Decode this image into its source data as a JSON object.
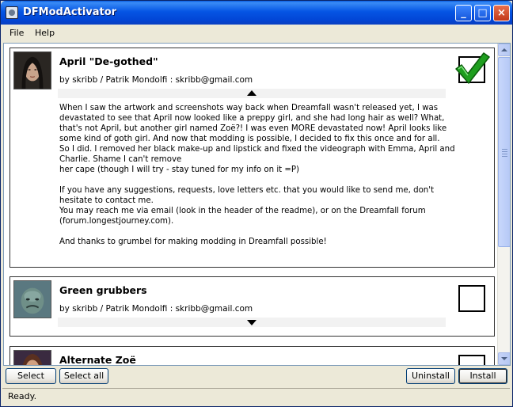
{
  "window": {
    "title": "DFModActivator"
  },
  "titlebar_buttons": {
    "minimize": "_",
    "maximize": "□",
    "close": "×"
  },
  "menu": {
    "file": "File",
    "help": "Help"
  },
  "mods": [
    {
      "title": "April \"De-gothed\"",
      "author": "by skribb / Patrik Mondolfi : skribb@gmail.com",
      "checked": true,
      "expanded": true,
      "description": [
        "When I saw the artwork and screenshots way back when Dreamfall wasn't released yet, I was\ndevastated to see that April now looked like a preppy girl, and she had long hair as well? What,\nthat's not April, but another girl named Zoë?! I was even MORE devastated now! April looks like\nsome kind of goth girl. And now that modding is possible, I decided to fix this once and for all.\nSo I did. I removed her black make-up and lipstick and fixed the videograph with Emma, April and\nCharlie. Shame I can't remove\nher cape (though I will try - stay tuned for my info on it =P)",
        "If you have any suggestions, requests, love letters etc. that you would like to send me, don't\nhesitate to contact me.\nYou may reach me via email (look in the header of the readme), or on the Dreamfall forum\n(forum.longestjourney.com).",
        "And thanks to grumbel for making modding in Dreamfall possible!"
      ]
    },
    {
      "title": "Green grubbers",
      "author": "by skribb / Patrik Mondolfi : skribb@gmail.com",
      "checked": false,
      "expanded": false
    },
    {
      "title": "Alternate Zoë",
      "checked": false,
      "expanded": false
    }
  ],
  "buttons": {
    "select_none": "Select none",
    "select_all": "Select all",
    "uninstall": "Uninstall",
    "install": "Install"
  },
  "status": {
    "text": "Ready."
  },
  "colors": {
    "titlebar": "#0246d6",
    "checkmark": "#1e9e1e",
    "window_bg": "#ece9d8"
  }
}
